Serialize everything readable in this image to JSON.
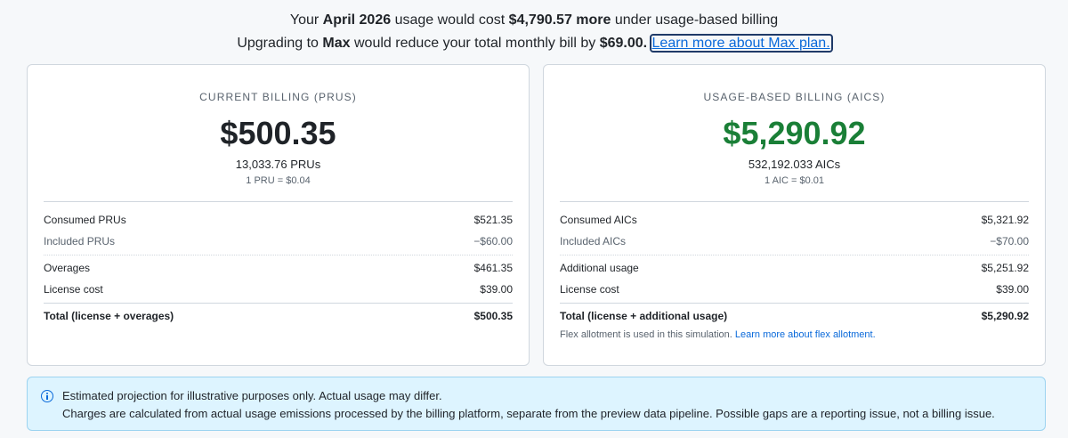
{
  "header": {
    "line1_prefix": "Your",
    "line1_month": "April 2026",
    "line1_mid": "usage would cost",
    "line1_amount": "$4,790.57 more",
    "line1_suffix": "under usage-based billing",
    "line2_prefix": "Upgrading to",
    "line2_plan": "Max",
    "line2_mid": "would reduce your total monthly bill by",
    "line2_amount": "$69.00.",
    "learn_more_label": "Learn more about Max plan."
  },
  "current": {
    "title": "CURRENT BILLING (PRUS)",
    "amount": "$500.35",
    "units": "13,033.76 PRUs",
    "rate": "1 PRU = $0.04",
    "rows": [
      {
        "label": "Consumed PRUs",
        "value": "$521.35"
      },
      {
        "label": "Included PRUs",
        "value": "−$60.00"
      },
      {
        "label": "Overages",
        "value": "$461.35"
      },
      {
        "label": "License cost",
        "value": "$39.00"
      },
      {
        "label": "Total (license + overages)",
        "value": "$500.35"
      }
    ]
  },
  "usage": {
    "title": "USAGE-BASED BILLING (AICS)",
    "amount": "$5,290.92",
    "units": "532,192.033 AICs",
    "rate": "1 AIC = $0.01",
    "rows": [
      {
        "label": "Consumed AICs",
        "value": "$5,321.92"
      },
      {
        "label": "Included AICs",
        "value": "−$70.00"
      },
      {
        "label": "Additional usage",
        "value": "$5,251.92"
      },
      {
        "label": "License cost",
        "value": "$39.00"
      },
      {
        "label": "Total (license + additional usage)",
        "value": "$5,290.92"
      }
    ],
    "flex_note": "Flex allotment is used in this simulation.",
    "flex_link": "Learn more about flex allotment."
  },
  "notice": {
    "icon": "info-icon",
    "line1": "Estimated projection for illustrative purposes only. Actual usage may differ.",
    "line2": "Charges are calculated from actual usage emissions processed by the billing platform, separate from the preview data pipeline. Possible gaps are a reporting issue, not a billing issue."
  },
  "colors": {
    "accent": "#0969da",
    "positive": "#1a7f37",
    "notice_bg": "#ddf4ff"
  }
}
